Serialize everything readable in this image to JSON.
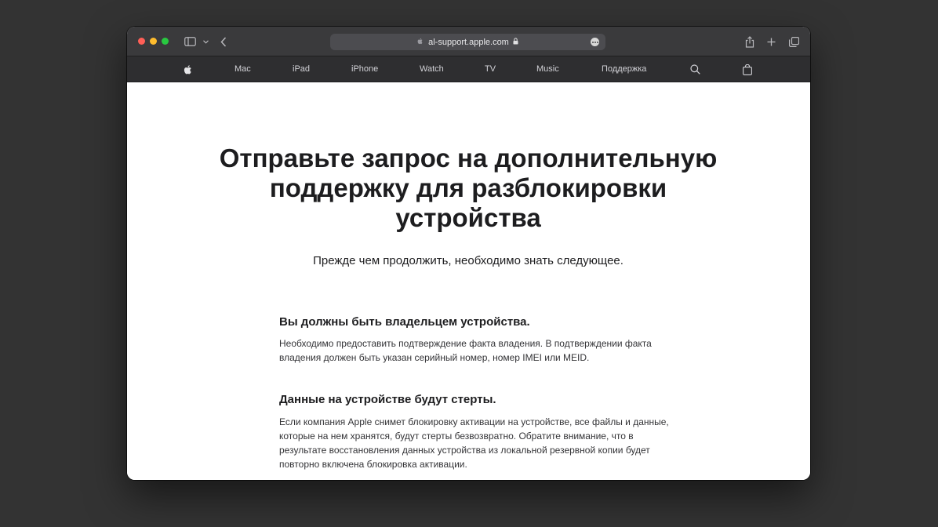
{
  "browser": {
    "url_text": "al-support.apple.com",
    "icons": [
      "sidebar-icon",
      "chevron-down-icon",
      "back-icon",
      "lock-icon",
      "more-icon",
      "share-icon",
      "new-tab-icon",
      "tabs-overview-icon"
    ]
  },
  "nav": {
    "items": [
      "Mac",
      "iPad",
      "iPhone",
      "Watch",
      "TV",
      "Music",
      "Поддержка"
    ],
    "icons": [
      "apple-logo-icon",
      "search-icon",
      "bag-icon"
    ]
  },
  "page": {
    "title": "Отправьте запрос на дополнительную поддержку для разблокировки устройства",
    "subtitle": "Прежде чем продолжить, необходимо знать следующее.",
    "sections": [
      {
        "heading": "Вы должны быть владельцем устройства.",
        "body": "Необходимо предоставить подтверждение факта владения. В подтверждении факта владения должен быть указан серийный номер, номер IMEI или MEID."
      },
      {
        "heading": "Данные на устройстве будут стерты.",
        "body": "Если компания Apple снимет блокировку активации на устройстве, все файлы и данные, которые на нем хранятся, будут стерты безвозвратно. Обратите внимание, что в результате восстановления данных устройства из локальной резервной копии будет повторно включена блокировка активации."
      }
    ]
  },
  "colors": {
    "background": "#333333",
    "titlebar": "#3a3a3c",
    "navbar": "#2e2e30",
    "close": "#ff5f57",
    "minimize": "#febc2e",
    "zoom": "#28c840",
    "text": "#1d1d1f"
  }
}
